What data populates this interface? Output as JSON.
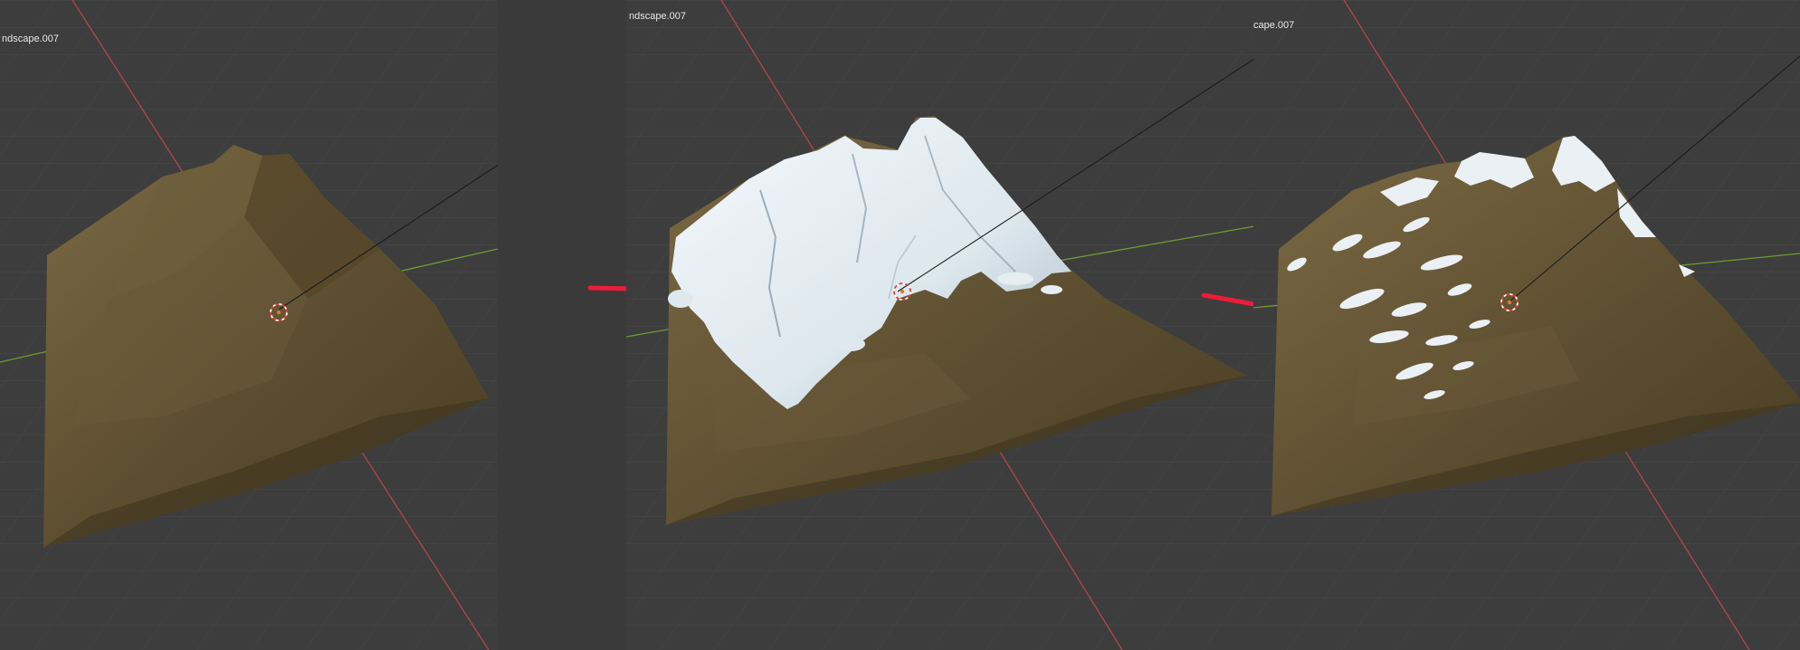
{
  "viewports": [
    {
      "object_label": "ndscape.007",
      "terrain": "bare rock"
    },
    {
      "object_label": "ndscape.007",
      "terrain": "heavy snow cover"
    },
    {
      "object_label": "cape.007",
      "terrain": "light snow patches"
    }
  ],
  "colors": {
    "viewport_bg": "#3d3d3d",
    "grid_line": "#4a4a4a",
    "x_axis": "#b5444e",
    "y_axis": "#6e9a34",
    "rock_dark": "#3e3320",
    "rock_mid": "#6a5a3a",
    "rock_light": "#8d7a52",
    "snow": "#eef4f8",
    "snow_shadow": "#a9bac6",
    "arrow": "#ee1c3a",
    "origin_marker": "#e07a28"
  },
  "icons": [
    "origin-cursor-icon",
    "annotation-arrow-icon"
  ]
}
